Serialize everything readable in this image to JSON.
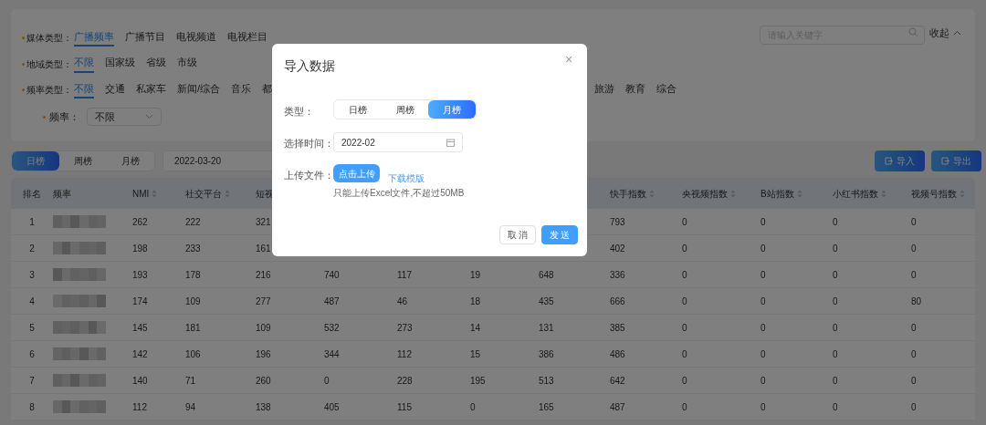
{
  "filters": [
    {
      "label": "媒体类型：",
      "options": [
        {
          "label": "广播频率",
          "selected": true
        },
        {
          "label": "广播节目",
          "selected": false
        },
        {
          "label": "电视频道",
          "selected": false
        },
        {
          "label": "电视栏目",
          "selected": false
        }
      ]
    },
    {
      "label": "地域类型：",
      "options": [
        {
          "label": "不限",
          "selected": true
        },
        {
          "label": "国家级",
          "selected": false
        },
        {
          "label": "省级",
          "selected": false
        },
        {
          "label": "市级",
          "selected": false
        }
      ]
    },
    {
      "label": "频率类型：",
      "options": [
        {
          "label": "不限",
          "selected": true
        },
        {
          "label": "交通",
          "selected": false
        },
        {
          "label": "私家车",
          "selected": false
        },
        {
          "label": "新闻/综合",
          "selected": false
        },
        {
          "label": "音乐",
          "selected": false
        },
        {
          "label": "都",
          "selected": false
        }
      ],
      "options_after_dialog": [
        {
          "label": "旅游",
          "selected": false
        },
        {
          "label": "教育",
          "selected": false
        },
        {
          "label": "综合",
          "selected": false
        }
      ]
    }
  ],
  "frequency_select": {
    "label": "频率：",
    "value": "不限"
  },
  "search": {
    "placeholder": "请输入关键字"
  },
  "collapse": "收起",
  "view_tabs": [
    {
      "label": "日榜",
      "selected": true
    },
    {
      "label": "周榜",
      "selected": false
    },
    {
      "label": "月榜",
      "selected": false
    }
  ],
  "date": "2022-03-20",
  "actions": [
    "导入",
    "导出"
  ],
  "table": {
    "columns_before_dialog": [
      {
        "label": "排名",
        "sortable": false
      },
      {
        "label": "频率",
        "sortable": false
      },
      {
        "label": "NMI",
        "sortable": true
      },
      {
        "label": "社交平台",
        "sortable": true
      },
      {
        "label": "短视",
        "sortable": false
      }
    ],
    "columns_after_dialog": [
      {
        "label": "快手指数",
        "sortable": true
      },
      {
        "label": "央视频指数",
        "sortable": true
      },
      {
        "label": "B站指数",
        "sortable": true
      },
      {
        "label": "小红书指数",
        "sortable": true
      },
      {
        "label": "视频号指数",
        "sortable": true
      }
    ],
    "rows": [
      {
        "cells": [
          "1",
          "262",
          "222",
          "321",
          "793",
          "0",
          "0",
          "0",
          "0"
        ]
      },
      {
        "cells": [
          "2",
          "198",
          "233",
          "161",
          "402",
          "0",
          "0",
          "0",
          "0"
        ]
      },
      {
        "cells": [
          "3",
          "193",
          "178",
          "216",
          "740",
          "117",
          "19",
          "648",
          "336",
          "0",
          "0",
          "0",
          "0"
        ]
      },
      {
        "cells": [
          "4",
          "174",
          "109",
          "277",
          "487",
          "46",
          "18",
          "435",
          "666",
          "0",
          "0",
          "0",
          "80"
        ]
      },
      {
        "cells": [
          "5",
          "145",
          "181",
          "109",
          "532",
          "273",
          "14",
          "131",
          "385",
          "0",
          "0",
          "0",
          "0"
        ]
      },
      {
        "cells": [
          "6",
          "142",
          "106",
          "196",
          "344",
          "112",
          "15",
          "386",
          "486",
          "0",
          "0",
          "0",
          "0"
        ]
      },
      {
        "cells": [
          "7",
          "140",
          "71",
          "260",
          "0",
          "228",
          "195",
          "513",
          "642",
          "0",
          "0",
          "0",
          "0"
        ]
      },
      {
        "cells": [
          "8",
          "112",
          "94",
          "138",
          "405",
          "115",
          "0",
          "165",
          "487",
          "0",
          "0",
          "0",
          "0"
        ]
      }
    ]
  },
  "dialog": {
    "title": "导入数据",
    "close": "×",
    "type_label": "类型：",
    "type_tabs": [
      {
        "label": "日榜",
        "selected": false
      },
      {
        "label": "周榜",
        "selected": false
      },
      {
        "label": "月榜",
        "selected": true
      }
    ],
    "time_label": "选择时间：",
    "time_value": "2022-02",
    "file_label": "上传文件：",
    "upload_button": "点击上传",
    "template_link": "下载模版",
    "hint": "只能上传Excel文件,不超过50MB",
    "buttons": [
      {
        "label": "取 消",
        "kind": "secondary"
      },
      {
        "label": "发 送",
        "kind": "primary"
      }
    ]
  }
}
